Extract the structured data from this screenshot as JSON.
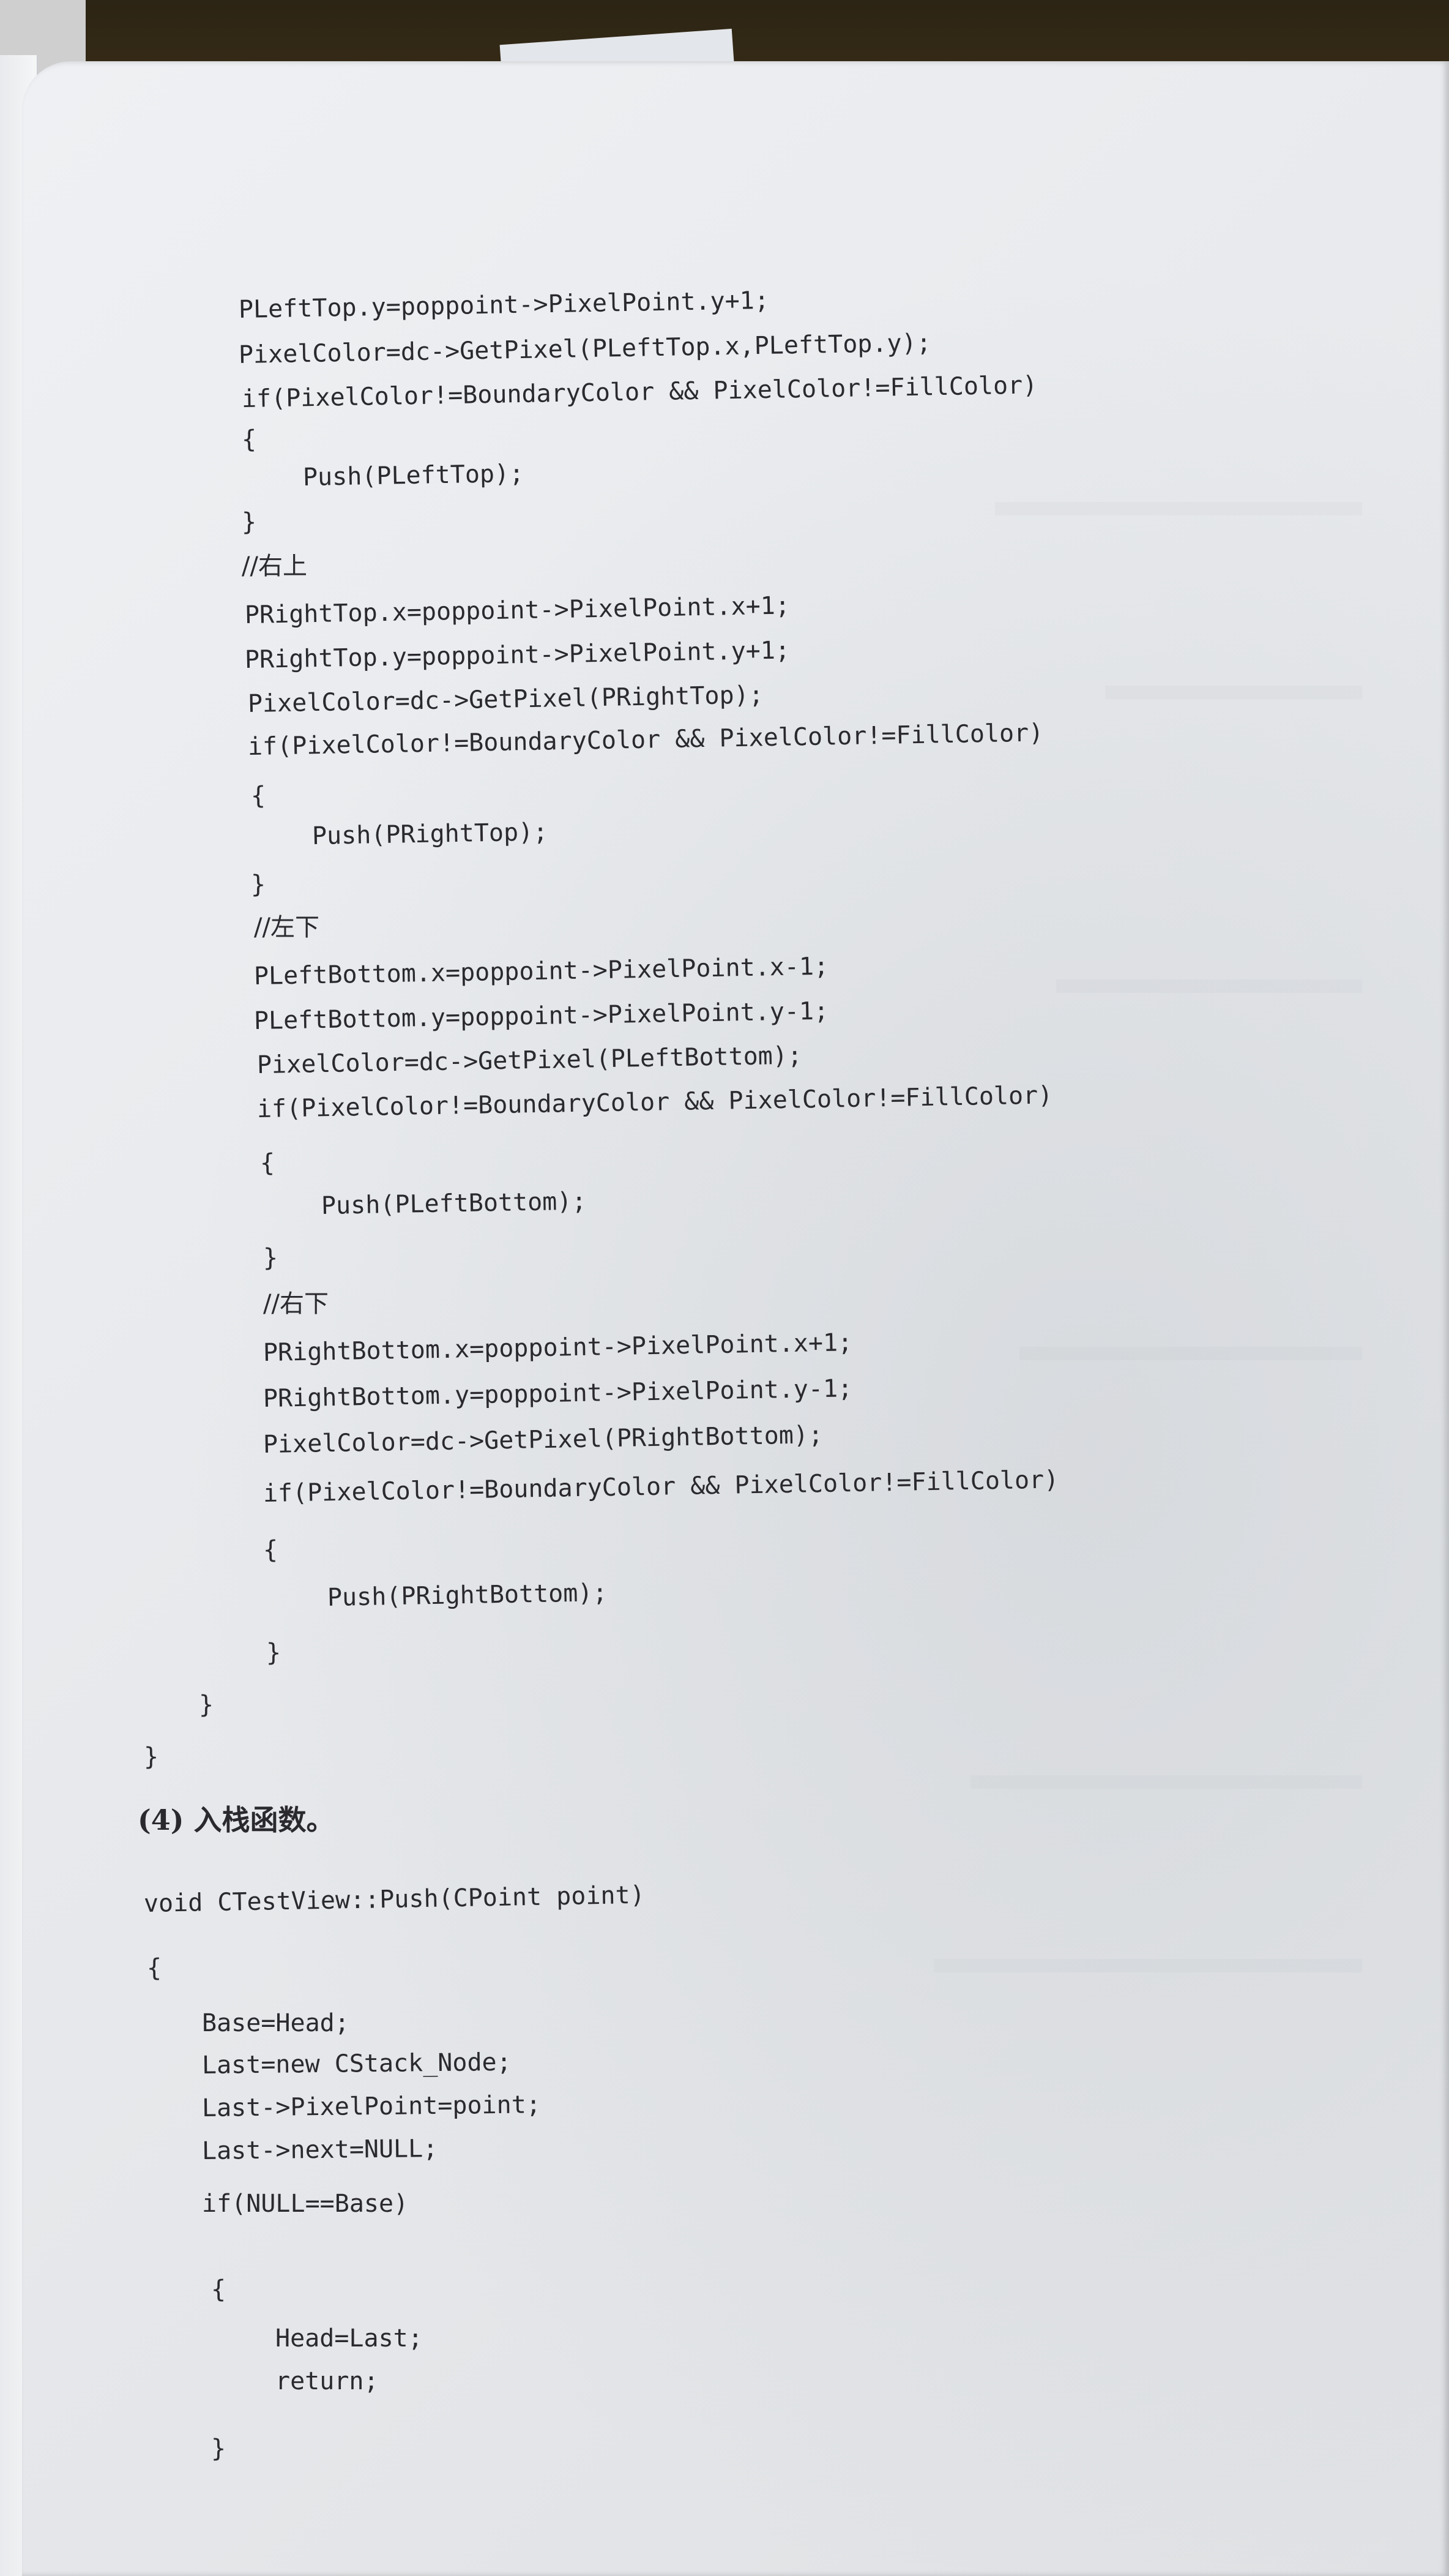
{
  "lines": [
    "PLeftTop.y=poppoint->PixelPoint.y+1;",
    "PixelColor=dc->GetPixel(PLeftTop.x,PLeftTop.y);",
    "if(PixelColor!=BoundaryColor && PixelColor!=FillColor)",
    "{",
    "Push(PLeftTop);",
    "}",
    "//右上",
    "PRightTop.x=poppoint->PixelPoint.x+1;",
    "PRightTop.y=poppoint->PixelPoint.y+1;",
    "PixelColor=dc->GetPixel(PRightTop);",
    "if(PixelColor!=BoundaryColor && PixelColor!=FillColor)",
    "{",
    "Push(PRightTop);",
    "}",
    "//左下",
    "PLeftBottom.x=poppoint->PixelPoint.x-1;",
    "PLeftBottom.y=poppoint->PixelPoint.y-1;",
    "PixelColor=dc->GetPixel(PLeftBottom);",
    "if(PixelColor!=BoundaryColor && PixelColor!=FillColor)",
    "{",
    "Push(PLeftBottom);",
    "}",
    "//右下",
    "PRightBottom.x=poppoint->PixelPoint.x+1;",
    "PRightBottom.y=poppoint->PixelPoint.y-1;",
    "PixelColor=dc->GetPixel(PRightBottom);",
    "if(PixelColor!=BoundaryColor && PixelColor!=FillColor)",
    "{",
    "Push(PRightBottom);",
    "}",
    "}",
    "}",
    "(4) 入栈函数。",
    "void CTestView::Push(CPoint point)",
    "{",
    "Base=Head;",
    "Last=new CStack_Node;",
    "Last->PixelPoint=point;",
    "Last->next=NULL;",
    "if(NULL==Base)",
    "{",
    "Head=Last;",
    "return;",
    "}"
  ]
}
